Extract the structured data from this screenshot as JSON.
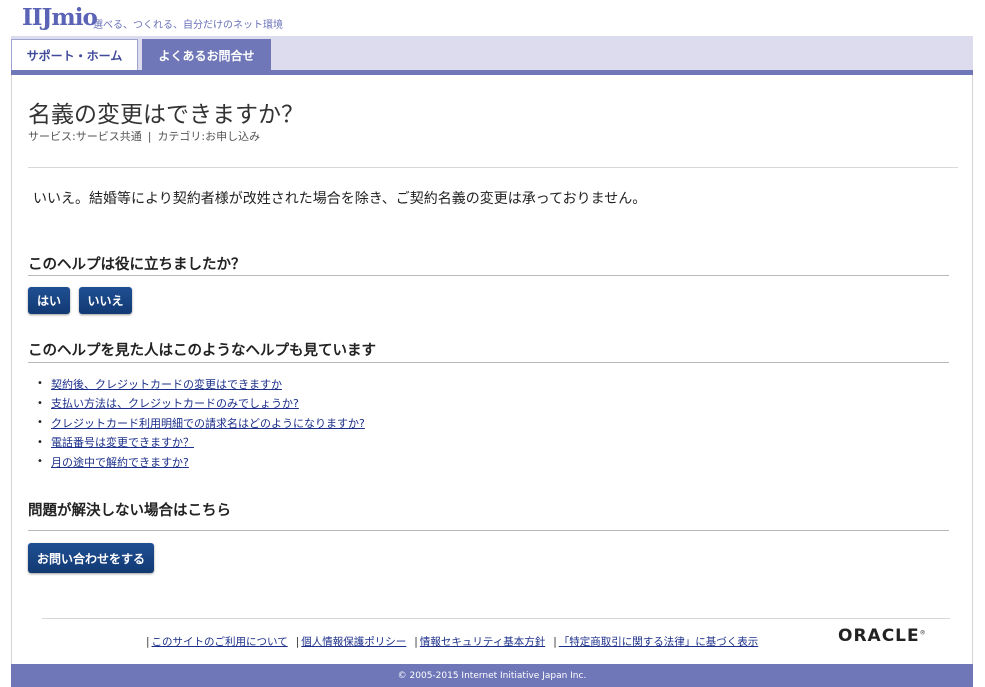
{
  "header": {
    "logo": "IIJmio",
    "tagline": "選べる、つくれる、自分だけのネット環境"
  },
  "tabs": [
    {
      "label": "サポート・ホーム",
      "active": true
    },
    {
      "label": "よくあるお問合せ",
      "active": false
    }
  ],
  "question": {
    "title": "名義の変更はできますか？",
    "service_label": "サービス:",
    "service_value": "サービス共通",
    "separator": "|",
    "category_label": "カテゴリ:",
    "category_value": "お申し込み"
  },
  "answer": "いいえ。結婚等により契約者様が改姓された場合を除き、ご契約名義の変更は承っておりません。",
  "feedback": {
    "heading": "このヘルプは役に立ちましたか？",
    "yes_label": "はい",
    "no_label": "いいえ"
  },
  "related": {
    "heading": "このヘルプを見た人はこのようなヘルプも見ています",
    "items": [
      "契約後、クレジットカードの変更はできますか",
      "支払い方法は、クレジットカードのみでしょうか?",
      "クレジットカード利用明細での請求名はどのようになりますか?",
      "電話番号は変更できますか？",
      "月の途中で解約できますか?"
    ]
  },
  "contact": {
    "heading": "問題が解決しない場合はこちら",
    "button_label": "お問い合わせをする"
  },
  "footer": {
    "links": [
      "このサイトのご利用について",
      "個人情報保護ポリシー",
      "情報セキュリティ基本方針",
      "「特定商取引に関する法律」に基づく表示"
    ],
    "link_separator": "|",
    "vendor_logo": "ORACLE",
    "copyright": "© 2005-2015 Internet Initiative Japan Inc."
  },
  "colors": {
    "brand": "#6f77b8",
    "button": "#1f4f93",
    "link": "#1c2f8a"
  }
}
